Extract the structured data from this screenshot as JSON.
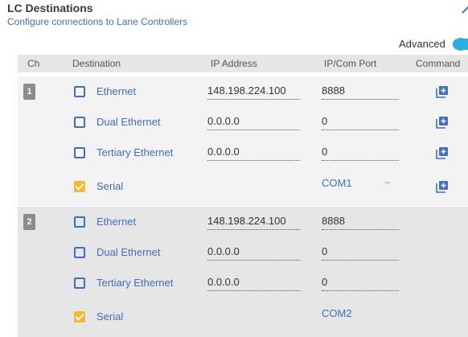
{
  "header": {
    "title": "LC Destinations",
    "subtitle": "Configure connections to Lane Controllers"
  },
  "advanced": {
    "label": "Advanced",
    "enabled": true,
    "color": "#2aaee6"
  },
  "table": {
    "columns": [
      "Ch",
      "Destination",
      "IP Address",
      "IP/Com Port",
      "Command"
    ]
  },
  "groups": [
    {
      "ch": "1",
      "rows": [
        {
          "destination": "Ethernet",
          "checked": false,
          "ip": "148.198.224.100",
          "port": "8888"
        },
        {
          "destination": "Dual Ethernet",
          "checked": false,
          "ip": "0.0.0.0",
          "port": "0"
        },
        {
          "destination": "Tertiary Ethernet",
          "checked": false,
          "ip": "0.0.0.0",
          "port": "0"
        },
        {
          "destination": "Serial",
          "checked": true,
          "com": "COM1"
        }
      ]
    },
    {
      "ch": "2",
      "rows": [
        {
          "destination": "Ethernet",
          "checked": false,
          "ip": "148.198.224.100",
          "port": "8888"
        },
        {
          "destination": "Dual Ethernet",
          "checked": false,
          "ip": "0.0.0.0",
          "port": "0"
        },
        {
          "destination": "Tertiary Ethernet",
          "checked": false,
          "ip": "0.0.0.0",
          "port": "0"
        },
        {
          "destination": "Serial",
          "checked": true,
          "com": "COM2"
        }
      ]
    }
  ],
  "colors": {
    "link": "#3f6ec4",
    "checked": "#f5b82e",
    "badge": "#8c8c8c"
  },
  "icons": {
    "command": "add-box-icon",
    "collapse": "chevron-up-icon"
  }
}
